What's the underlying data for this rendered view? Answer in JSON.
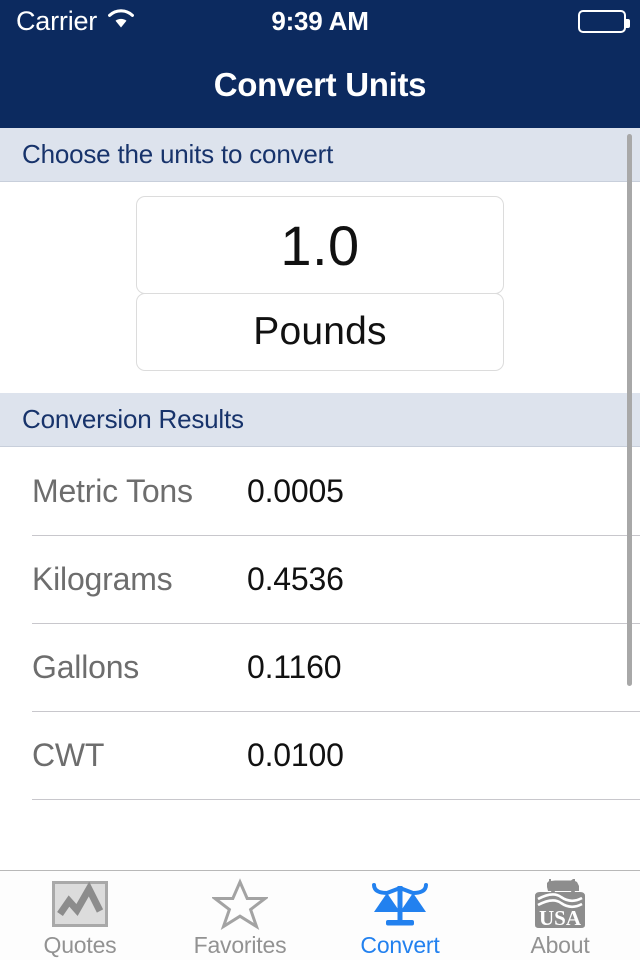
{
  "status_bar": {
    "carrier": "Carrier",
    "wifi_icon": "wifi-icon",
    "time": "9:39 AM",
    "battery_icon": "battery-icon"
  },
  "nav_bar": {
    "title": "Convert Units"
  },
  "colors": {
    "nav_background": "#0c2a5f",
    "section_header_background": "#dde3ed",
    "section_header_text": "#17336b",
    "active_tab": "#2281ef",
    "inactive_tab": "#929292"
  },
  "input_section": {
    "header": "Choose the units to convert",
    "amount_value": "1.0",
    "amount_placeholder": "1.0",
    "unit_value": "Pounds",
    "unit_placeholder": "Pounds"
  },
  "results_section": {
    "header": "Conversion Results",
    "rows": [
      {
        "label": "Metric Tons",
        "value": "0.0005"
      },
      {
        "label": "Kilograms",
        "value": "0.4536"
      },
      {
        "label": "Gallons",
        "value": "0.1160"
      },
      {
        "label": "CWT",
        "value": "0.0100"
      }
    ]
  },
  "tab_bar": {
    "items": [
      {
        "label": "Quotes",
        "icon": "chart-icon",
        "active": false
      },
      {
        "label": "Favorites",
        "icon": "star-icon",
        "active": false
      },
      {
        "label": "Convert",
        "icon": "scale-icon",
        "active": true
      },
      {
        "label": "About",
        "icon": "usda-logo-icon",
        "active": false
      }
    ]
  }
}
